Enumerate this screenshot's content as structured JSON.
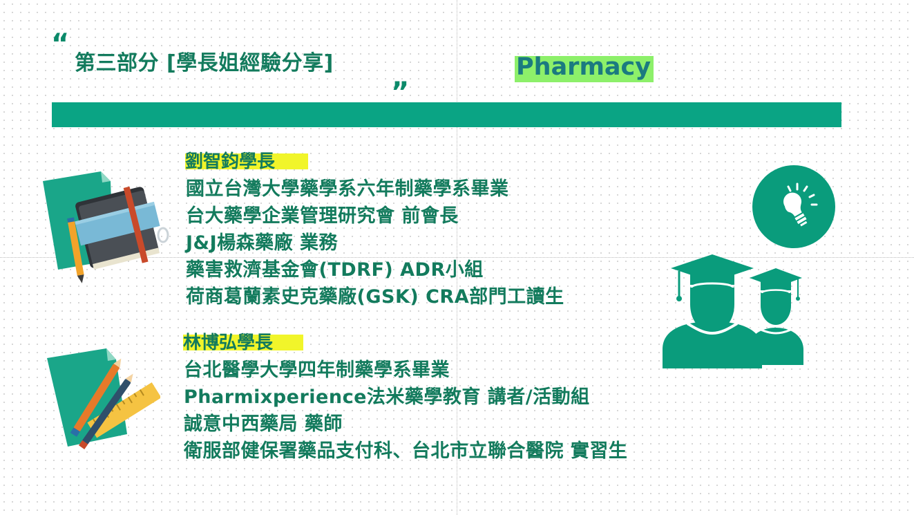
{
  "slide": {
    "title": "第三部分 [學長姐經驗分享]",
    "open_quote": "“",
    "close_quote": "”",
    "tag": "Pharmacy"
  },
  "profiles": [
    {
      "name": "劉智鈞學長",
      "lines": [
        "國立台灣大學藥學系六年制藥學系畢業",
        "台大藥學企業管理研究會 前會長",
        "J&J楊森藥廠 業務",
        "藥害救濟基金會(TDRF) ADR小組",
        "荷商葛蘭素史克藥廠(GSK) CRA部門工讀生"
      ]
    },
    {
      "name": "林博弘學長",
      "lines": [
        "台北醫學大學四年制藥學系畢業",
        "Pharmixperience法米藥學教育 講者/活動組",
        "誠意中西藥局 藥師",
        "衛服部健保署藥品支付科、台北市立聯合醫院 實習生"
      ]
    }
  ],
  "colors": {
    "accent": "#0aa484",
    "text": "#137b5d",
    "highlight_yellow": "#f1f52a",
    "highlight_green": "#8df06a"
  },
  "icons": [
    "notebook-icon",
    "stationery-icon",
    "lightbulb-icon",
    "graduates-icon"
  ]
}
